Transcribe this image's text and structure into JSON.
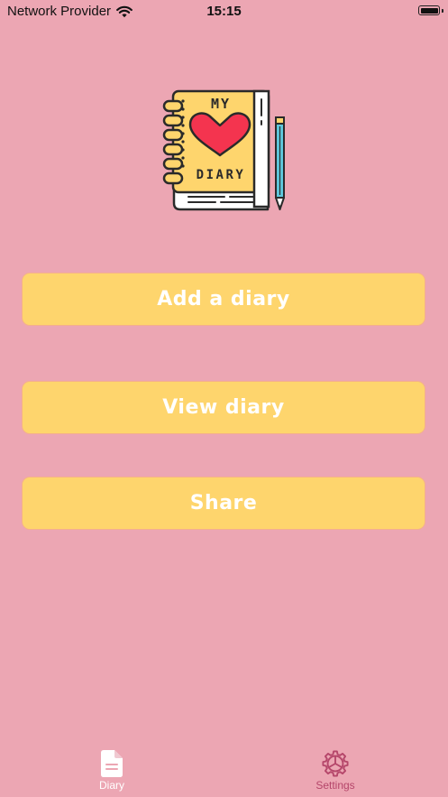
{
  "status_bar": {
    "carrier": "Network Provider",
    "time": "15:15"
  },
  "logo": {
    "line1": "MY",
    "line2": "DIARY"
  },
  "buttons": {
    "add": "Add a diary",
    "view": "View diary",
    "share": "Share"
  },
  "tabs": [
    {
      "label": "Diary",
      "icon": "document-icon",
      "selected": true
    },
    {
      "label": "Settings",
      "icon": "gear-icon",
      "selected": false
    }
  ],
  "colors": {
    "background": "#eca6b3",
    "button": "#fed56d",
    "button_border": "#f4b08c",
    "button_text": "#ffffff",
    "tab_active": "#ffffff",
    "tab_inactive": "#b5466a",
    "heart": "#f4344f",
    "pencil": "#5ec8dd"
  }
}
